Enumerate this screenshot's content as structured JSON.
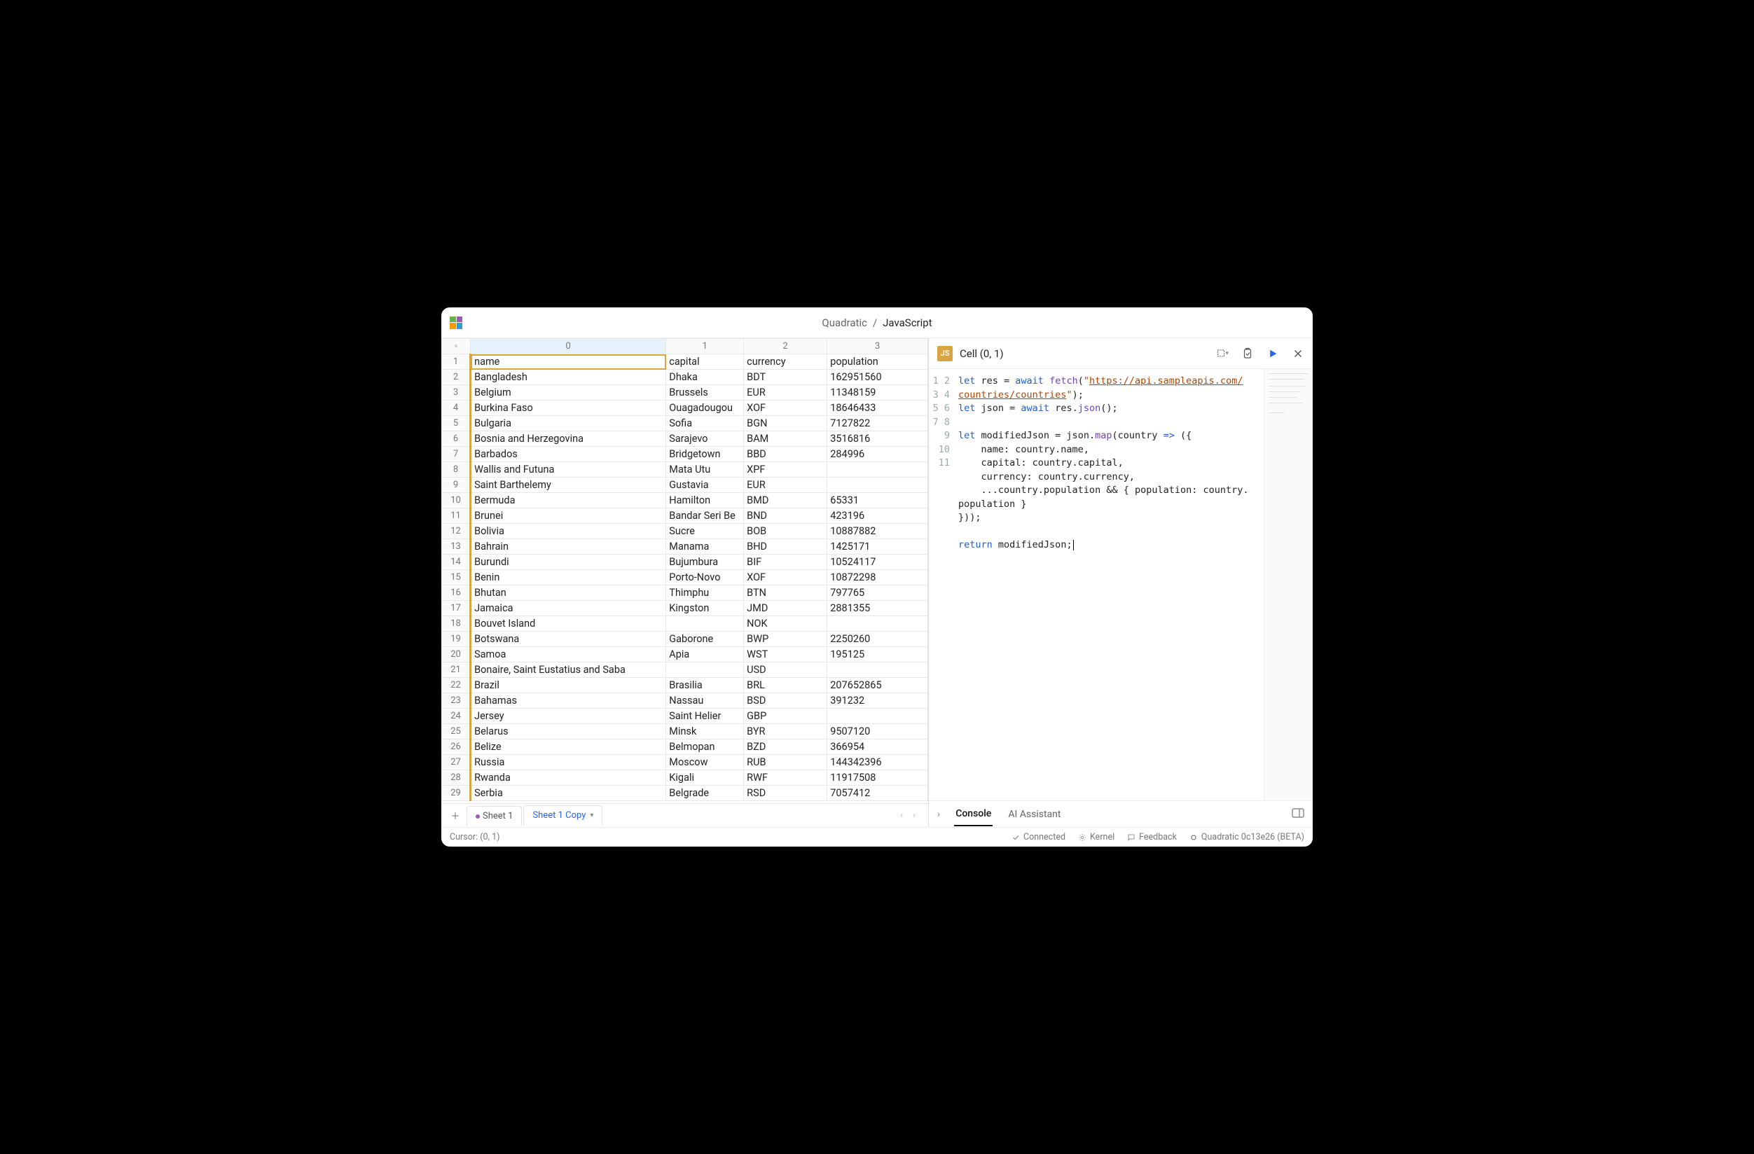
{
  "breadcrumb": {
    "app": "Quadratic",
    "sep": "/",
    "current": "JavaScript"
  },
  "columns": [
    "0",
    "1",
    "2",
    "3"
  ],
  "headers": [
    "name",
    "capital",
    "currency",
    "population"
  ],
  "rows": [
    {
      "n": "1",
      "name": "name",
      "capital": "capital",
      "currency": "currency",
      "population": "population"
    },
    {
      "n": "2",
      "name": "Bangladesh",
      "capital": "Dhaka",
      "currency": "BDT",
      "population": "162951560"
    },
    {
      "n": "3",
      "name": "Belgium",
      "capital": "Brussels",
      "currency": "EUR",
      "population": "11348159"
    },
    {
      "n": "4",
      "name": "Burkina Faso",
      "capital": "Ouagadougou",
      "currency": "XOF",
      "population": "18646433"
    },
    {
      "n": "5",
      "name": "Bulgaria",
      "capital": "Sofia",
      "currency": "BGN",
      "population": "7127822"
    },
    {
      "n": "6",
      "name": "Bosnia and Herzegovina",
      "capital": "Sarajevo",
      "currency": "BAM",
      "population": "3516816"
    },
    {
      "n": "7",
      "name": "Barbados",
      "capital": "Bridgetown",
      "currency": "BBD",
      "population": "284996"
    },
    {
      "n": "8",
      "name": "Wallis and Futuna",
      "capital": "Mata Utu",
      "currency": "XPF",
      "population": ""
    },
    {
      "n": "9",
      "name": "Saint Barthelemy",
      "capital": "Gustavia",
      "currency": "EUR",
      "population": ""
    },
    {
      "n": "10",
      "name": "Bermuda",
      "capital": "Hamilton",
      "currency": "BMD",
      "population": "65331"
    },
    {
      "n": "11",
      "name": "Brunei",
      "capital": "Bandar Seri Be",
      "currency": "BND",
      "population": "423196"
    },
    {
      "n": "12",
      "name": "Bolivia",
      "capital": "Sucre",
      "currency": "BOB",
      "population": "10887882"
    },
    {
      "n": "13",
      "name": "Bahrain",
      "capital": "Manama",
      "currency": "BHD",
      "population": "1425171"
    },
    {
      "n": "14",
      "name": "Burundi",
      "capital": "Bujumbura",
      "currency": "BIF",
      "population": "10524117"
    },
    {
      "n": "15",
      "name": "Benin",
      "capital": "Porto-Novo",
      "currency": "XOF",
      "population": "10872298"
    },
    {
      "n": "16",
      "name": "Bhutan",
      "capital": "Thimphu",
      "currency": "BTN",
      "population": "797765"
    },
    {
      "n": "17",
      "name": "Jamaica",
      "capital": "Kingston",
      "currency": "JMD",
      "population": "2881355"
    },
    {
      "n": "18",
      "name": "Bouvet Island",
      "capital": "",
      "currency": "NOK",
      "population": ""
    },
    {
      "n": "19",
      "name": "Botswana",
      "capital": "Gaborone",
      "currency": "BWP",
      "population": "2250260"
    },
    {
      "n": "20",
      "name": "Samoa",
      "capital": "Apia",
      "currency": "WST",
      "population": "195125"
    },
    {
      "n": "21",
      "name": "Bonaire, Saint Eustatius and Saba",
      "capital": "",
      "currency": "USD",
      "population": ""
    },
    {
      "n": "22",
      "name": "Brazil",
      "capital": "Brasilia",
      "currency": "BRL",
      "population": "207652865"
    },
    {
      "n": "23",
      "name": "Bahamas",
      "capital": "Nassau",
      "currency": "BSD",
      "population": "391232"
    },
    {
      "n": "24",
      "name": "Jersey",
      "capital": "Saint Helier",
      "currency": "GBP",
      "population": ""
    },
    {
      "n": "25",
      "name": "Belarus",
      "capital": "Minsk",
      "currency": "BYR",
      "population": "9507120"
    },
    {
      "n": "26",
      "name": "Belize",
      "capital": "Belmopan",
      "currency": "BZD",
      "population": "366954"
    },
    {
      "n": "27",
      "name": "Russia",
      "capital": "Moscow",
      "currency": "RUB",
      "population": "144342396"
    },
    {
      "n": "28",
      "name": "Rwanda",
      "capital": "Kigali",
      "currency": "RWF",
      "population": "11917508"
    },
    {
      "n": "29",
      "name": "Serbia",
      "capital": "Belgrade",
      "currency": "RSD",
      "population": "7057412"
    }
  ],
  "sheets": {
    "tab1": "Sheet 1",
    "tab2": "Sheet 1 Copy"
  },
  "codeHeader": {
    "badge": "JS",
    "ref": "Cell (0, 1)"
  },
  "codeLines": [
    "1",
    "2",
    "3",
    "4",
    "5",
    "6",
    "7",
    "8",
    "9",
    "10",
    "11"
  ],
  "code": {
    "l1a": "let",
    "l1b": " res = ",
    "l1c": "await",
    "l1d": " ",
    "l1e": "fetch",
    "l1f": "(",
    "l1g": "\"",
    "l1h": "https://api.sampleapis.com/",
    "l1i": "countries/countries",
    "l1j": "\"",
    "l1k": ");",
    "l2a": "let",
    "l2b": " json = ",
    "l2c": "await",
    "l2d": " res.",
    "l2e": "json",
    "l2f": "();",
    "l4a": "let",
    "l4b": " modifiedJson = json.",
    "l4c": "map",
    "l4d": "(country ",
    "l4e": "=>",
    "l4f": " ({",
    "l5": "    name: country.name,",
    "l6": "    capital: country.capital,",
    "l7": "    currency: country.currency,",
    "l8": "    ...country.population && { population: country.",
    "l8b": "population }",
    "l9": "}));",
    "l11a": "return",
    "l11b": " modifiedJson;"
  },
  "console": {
    "tab1": "Console",
    "tab2": "AI Assistant"
  },
  "status": {
    "cursor": "Cursor: (0, 1)",
    "connected": "Connected",
    "kernel": "Kernel",
    "feedback": "Feedback",
    "version": "Quadratic 0c13e26 (BETA)"
  }
}
